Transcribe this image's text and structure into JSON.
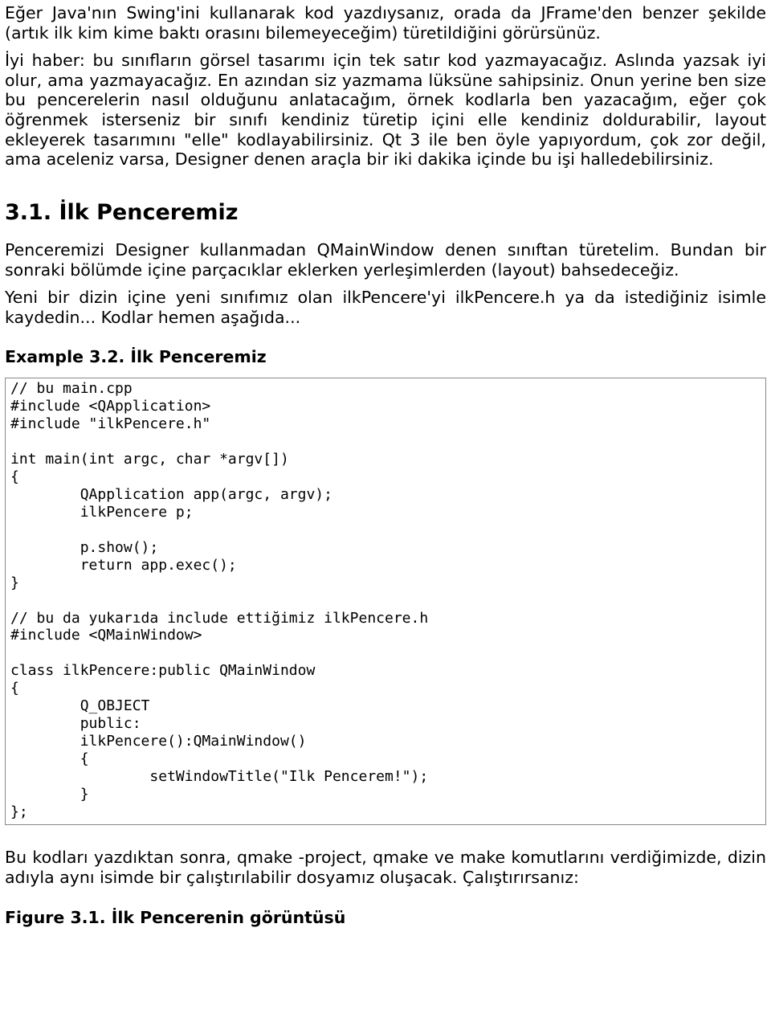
{
  "para1": "Eğer Java'nın Swing'ini kullanarak kod yazdıysanız, orada da JFrame'den benzer şekilde (artık ilk kim kime baktı orasını bilemeyeceğim) türetildiğini görürsünüz.",
  "para2": "İyi haber: bu sınıfların görsel tasarımı için tek satır kod yazmayacağız. Aslında yazsak iyi olur, ama yazmayacağız. En azından siz yazmama lüksüne sahipsiniz. Onun yerine ben size bu pencerelerin nasıl olduğunu anlatacağım, örnek kodlarla ben yazacağım, eğer çok öğrenmek isterseniz bir sınıfı kendiniz türetip içini elle kendiniz doldurabilir, layout ekleyerek tasarımını \"elle\" kodlayabilirsiniz. Qt 3 ile ben öyle yapıyordum, çok zor değil, ama aceleniz varsa, Designer denen araçla bir iki dakika içinde bu işi halledebilirsiniz.",
  "section_title": "3.1. İlk Penceremiz",
  "para3": "Penceremizi Designer kullanmadan QMainWindow denen sınıftan türetelim. Bundan bir sonraki bölümde içine parçacıklar eklerken yerleşimlerden (layout) bahsedeceğiz.",
  "para4": "Yeni bir dizin içine yeni sınıfımız olan ilkPencere'yi ilkPencere.h ya da istediğiniz isimle kaydedin... Kodlar hemen aşağıda...",
  "example_title": "Example 3.2. İlk Penceremiz",
  "code": "// bu main.cpp\n#include <QApplication>\n#include \"ilkPencere.h\"\n\nint main(int argc, char *argv[])\n{\n        QApplication app(argc, argv);\n        ilkPencere p;\n\n        p.show();\n        return app.exec();\n}\n\n// bu da yukarıda include ettiğimiz ilkPencere.h\n#include <QMainWindow>\n\nclass ilkPencere:public QMainWindow\n{\n        Q_OBJECT\n        public:\n        ilkPencere():QMainWindow()\n        {\n                setWindowTitle(\"Ilk Pencerem!\");\n        }\n};",
  "para5": "Bu kodları yazdıktan sonra, qmake -project, qmake ve make komutlarını verdiğimizde, dizin adıyla aynı isimde bir çalıştırılabilir dosyamız oluşacak. Çalıştırırsanız:",
  "figure_title": "Figure 3.1. İlk Pencerenin görüntüsü"
}
